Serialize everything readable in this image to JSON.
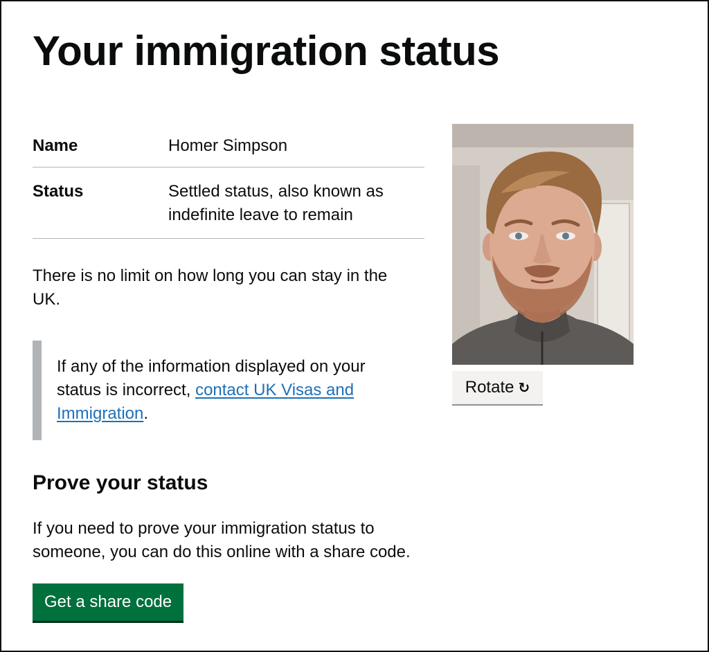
{
  "page": {
    "title": "Your immigration status"
  },
  "summary": {
    "rows": [
      {
        "key": "Name",
        "value": "Homer Simpson"
      },
      {
        "key": "Status",
        "value_lines": [
          "Settled status, also known as",
          "indefinite leave to remain"
        ]
      }
    ]
  },
  "body": {
    "limit_lines": [
      "There is no limit on how long you can stay in the",
      "UK."
    ]
  },
  "inset": {
    "line1": "If any of the information displayed on your",
    "line2_text": "status is incorrect, ",
    "link_part1": "contact UK Visas and",
    "link_part2": "Immigration",
    "trailing": "."
  },
  "prove": {
    "heading": "Prove your status",
    "lines": [
      "If you need to prove your immigration status to",
      "someone, you can do this online with a share code."
    ],
    "button_label": "Get a share code"
  },
  "photo": {
    "rotate_label": "Rotate",
    "rotate_icon": "↻",
    "alt": "Photo of the status holder"
  },
  "colors": {
    "link": "#1d70b8",
    "button_green": "#00703c",
    "border_grey": "#b1b4b6",
    "rotate_bg": "#f3f2f1"
  }
}
